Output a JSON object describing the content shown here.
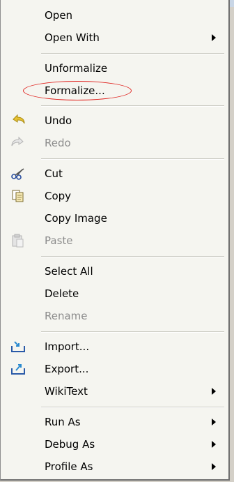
{
  "menu": {
    "items": [
      {
        "label": "Open",
        "enabled": true,
        "submenu": false,
        "icon": null
      },
      {
        "label": "Open With",
        "enabled": true,
        "submenu": true,
        "icon": null
      },
      {
        "label": "Unformalize",
        "enabled": true,
        "submenu": false,
        "icon": null
      },
      {
        "label": "Formalize...",
        "enabled": true,
        "submenu": false,
        "icon": null,
        "annotated": true
      },
      {
        "label": "Undo",
        "enabled": true,
        "submenu": false,
        "icon": "undo-icon"
      },
      {
        "label": "Redo",
        "enabled": false,
        "submenu": false,
        "icon": "redo-icon"
      },
      {
        "label": "Cut",
        "enabled": true,
        "submenu": false,
        "icon": "scissors-icon"
      },
      {
        "label": "Copy",
        "enabled": true,
        "submenu": false,
        "icon": "copy-icon"
      },
      {
        "label": "Copy Image",
        "enabled": true,
        "submenu": false,
        "icon": null
      },
      {
        "label": "Paste",
        "enabled": false,
        "submenu": false,
        "icon": "paste-icon"
      },
      {
        "label": "Select All",
        "enabled": true,
        "submenu": false,
        "icon": null
      },
      {
        "label": "Delete",
        "enabled": true,
        "submenu": false,
        "icon": null
      },
      {
        "label": "Rename",
        "enabled": false,
        "submenu": false,
        "icon": null
      },
      {
        "label": "Import...",
        "enabled": true,
        "submenu": false,
        "icon": "import-icon"
      },
      {
        "label": "Export...",
        "enabled": true,
        "submenu": false,
        "icon": "export-icon"
      },
      {
        "label": "WikiText",
        "enabled": true,
        "submenu": true,
        "icon": null
      },
      {
        "label": "Run As",
        "enabled": true,
        "submenu": true,
        "icon": null
      },
      {
        "label": "Debug As",
        "enabled": true,
        "submenu": true,
        "icon": null
      },
      {
        "label": "Profile As",
        "enabled": true,
        "submenu": true,
        "icon": null
      }
    ]
  },
  "colors": {
    "annotation": "#e0201c",
    "disabled_text": "#8c8c8c",
    "menu_bg": "#f5f5f0"
  }
}
